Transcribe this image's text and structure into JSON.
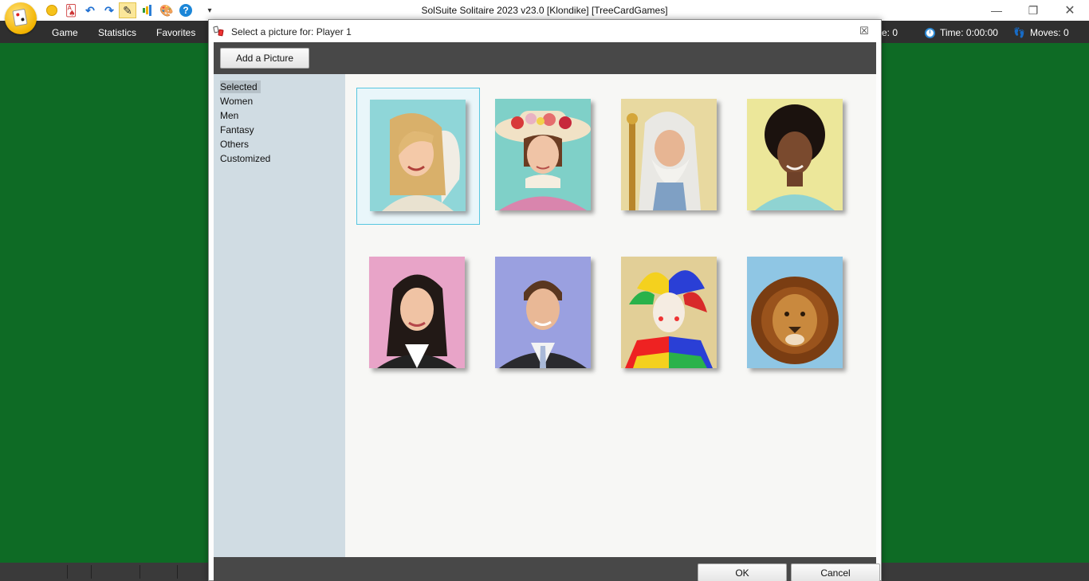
{
  "window": {
    "title": "SolSuite Solitaire 2023 v23.0  [Klondike]  [TreeCardGames]",
    "minimize_glyph": "—",
    "maximize_glyph": "❐",
    "close_glyph": "✕"
  },
  "quick_access": {
    "icons": [
      "new-game-icon",
      "cards-icon",
      "undo-icon",
      "redo-icon",
      "hint-wand-icon",
      "statistics-chart-icon",
      "palette-icon",
      "help-icon",
      "customize-dropdown-icon"
    ],
    "undo_glyph": "↶",
    "redo_glyph": "↷",
    "wand_glyph": "✎",
    "palette_glyph": "🎨",
    "help_glyph": "?",
    "more_glyph": "▾"
  },
  "menubar": {
    "items": [
      "Game",
      "Statistics",
      "Favorites"
    ],
    "score_partial": "e: 0",
    "time_label": "Time:  0:00:00",
    "moves_label": "Moves: 0"
  },
  "dialog": {
    "title": "Select a picture for: Player 1",
    "close_glyph": "☒",
    "add_button": "Add a Picture",
    "categories": [
      "Selected",
      "Women",
      "Men",
      "Fantasy",
      "Others",
      "Customized"
    ],
    "selected_category": "Selected",
    "pictures": [
      {
        "name": "angel-woman-portrait",
        "bg": "#8fd6d8",
        "selected": true
      },
      {
        "name": "lady-in-hat-portrait",
        "bg": "#7fd0c8",
        "selected": false
      },
      {
        "name": "wizard-old-man-portrait",
        "bg": "#e8d9a0",
        "selected": false
      },
      {
        "name": "curly-hair-woman-portrait",
        "bg": "#ece79a",
        "selected": false
      },
      {
        "name": "businesswoman-portrait",
        "bg": "#e8a4c8",
        "selected": false
      },
      {
        "name": "businessman-portrait",
        "bg": "#9aa0e0",
        "selected": false
      },
      {
        "name": "jester-portrait",
        "bg": "#e2cf97",
        "selected": false
      },
      {
        "name": "lion-portrait",
        "bg": "#8fc6e4",
        "selected": false
      }
    ],
    "ok_button": "OK",
    "cancel_button": "Cancel"
  },
  "colors": {
    "felt_green": "#0e6b25",
    "menubar_dark": "#2f2f2f",
    "selection_border": "#57c6e0",
    "sidebar_bg": "#d0dce3"
  }
}
